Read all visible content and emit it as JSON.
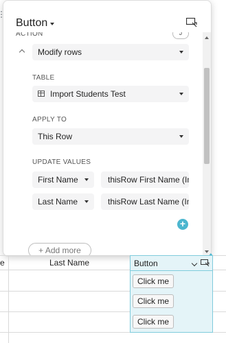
{
  "panel": {
    "title": "Button",
    "action_label": "ACTION",
    "action_badge": "J",
    "action_value": "Modify rows",
    "table_label": "TABLE",
    "table_value": "Import Students Test",
    "apply_label": "APPLY TO",
    "apply_value": "This Row",
    "update_label": "UPDATE VALUES",
    "updates": [
      {
        "field": "First Name",
        "value": "thisRow  First Name (Im"
      },
      {
        "field": "Last Name",
        "value": "thisRow  Last Name (Im"
      }
    ],
    "add_more": "+ Add more"
  },
  "grid": {
    "col_partial": "e",
    "col_last": "Last Name",
    "col_button": "Button",
    "buttons": [
      "Click me",
      "Click me",
      "Click me"
    ]
  },
  "colors": {
    "accent": "#4cb6cf",
    "selected_column_bg": "#e4f4f8"
  }
}
